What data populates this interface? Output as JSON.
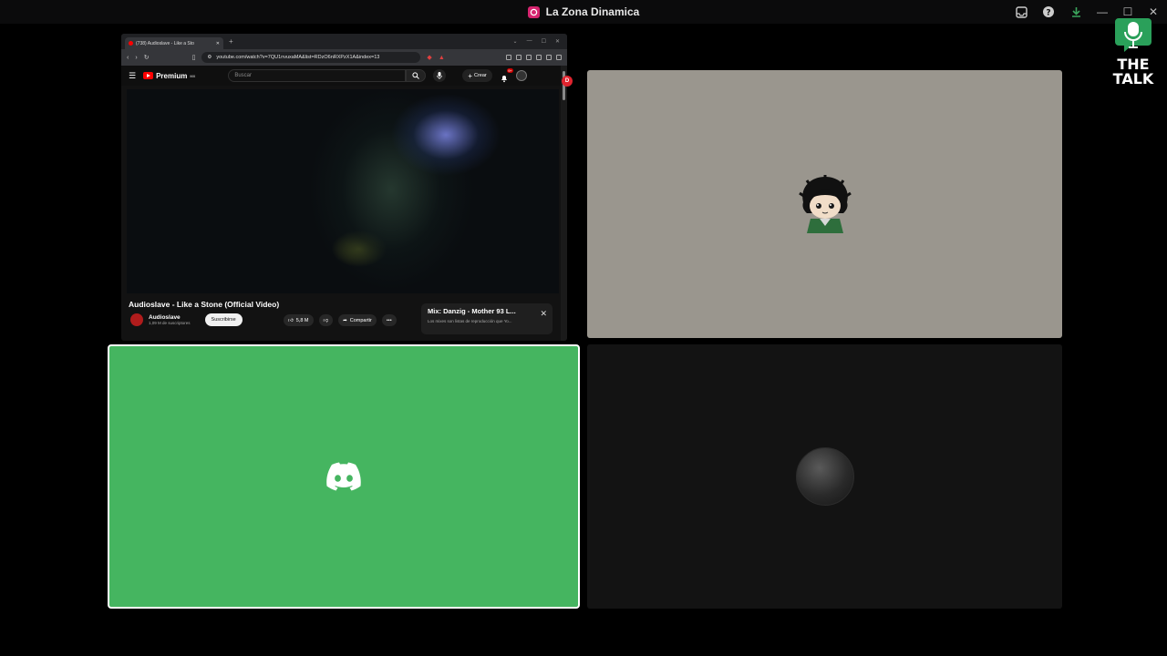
{
  "app": {
    "title": "La Zona Dinamica",
    "accent": "#d6246f"
  },
  "logo": {
    "line1": "THE",
    "line2": "TALK",
    "color": "#2aa05a"
  },
  "browser": {
    "tab_title": "(738) Audioslave - Like a Sto",
    "url": "youtube.com/watch?v=7QU1nvuxaMA&list=RDzO6nRXPzX1A&index=13",
    "youtube": {
      "brand": "Premium",
      "brand_sup": "MX",
      "search_placeholder": "Buscar",
      "create_label": "Crear",
      "notif_count": "9+",
      "video_title": "Audioslave - Like a Stone (Official Video)",
      "channel_name": "Audioslave",
      "channel_subs": "1,09 M de suscriptores",
      "subscribe_label": "Suscribirse",
      "likes": "5,8 M",
      "share_label": "Compartir",
      "mix_title": "Mix: Danzig - Mother 93 L...",
      "mix_subtitle": "Los mixes son listas de reproducción que Yo..."
    }
  },
  "tiles": {
    "user1_bg": "#9a968e",
    "user2_bg": "#45b560",
    "user3_bg": "#131313"
  }
}
